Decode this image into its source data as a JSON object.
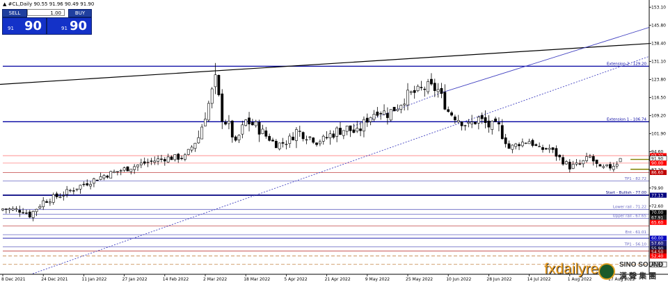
{
  "header": {
    "symbol_line": "#CL,Daily  90.55 91.96 90.49 91.90",
    "arrow_glyph": "▲"
  },
  "trade_panel": {
    "sell_label": "SELL",
    "buy_label": "BUY",
    "lot": "1.00",
    "sell_small": "91",
    "sell_big": "90",
    "buy_small": "91",
    "buy_big": "90"
  },
  "watermark": {
    "text": "fxdailyre",
    "brand": "SINO SOUND",
    "chinese": "漢 聲 集 團"
  },
  "colors": {
    "candle": "#000000",
    "level_line": "#0000a0",
    "channel_line": "#4040c0",
    "resistance_red": "#ff0000",
    "panel_blue": "#1432c8",
    "arrow_olive": "#808000"
  },
  "chart_data": {
    "type": "candlestick",
    "symbol": "#CL",
    "timeframe": "Daily",
    "ohlc_readout": [
      90.55,
      91.96,
      90.49,
      91.9
    ],
    "ylim": [
      45.0,
      156.0
    ],
    "y_ticks": [
      153.1,
      145.8,
      138.4,
      131.1,
      123.8,
      116.5,
      109.2,
      101.9,
      94.6,
      87.2,
      79.9,
      72.6
    ],
    "x_labels": [
      {
        "i": 0,
        "text": "8 Dec 2021"
      },
      {
        "i": 12,
        "text": "24 Dec 2021"
      },
      {
        "i": 24,
        "text": "11 Jan 2022"
      },
      {
        "i": 36,
        "text": "27 Jan 2022"
      },
      {
        "i": 48,
        "text": "14 Feb 2022"
      },
      {
        "i": 60,
        "text": "2 Mar 2022"
      },
      {
        "i": 72,
        "text": "18 Mar 2022"
      },
      {
        "i": 84,
        "text": "5 Apr 2022"
      },
      {
        "i": 96,
        "text": "21 Apr 2022"
      },
      {
        "i": 108,
        "text": "9 May 2022"
      },
      {
        "i": 120,
        "text": "25 May 2022"
      },
      {
        "i": 132,
        "text": "10 Jun 2022"
      },
      {
        "i": 144,
        "text": "28 Jun 2022"
      },
      {
        "i": 156,
        "text": "14 Jul 2022"
      },
      {
        "i": 168,
        "text": "1 Aug 2022"
      },
      {
        "i": 180,
        "text": "17 Aug 2022"
      }
    ],
    "anchors": [
      [
        0,
        71.5
      ],
      [
        6,
        70.8
      ],
      [
        8,
        69.0
      ],
      [
        12,
        74.5
      ],
      [
        18,
        77.5
      ],
      [
        24,
        81.5
      ],
      [
        30,
        85.0
      ],
      [
        36,
        87.5
      ],
      [
        42,
        90.0
      ],
      [
        48,
        92.0
      ],
      [
        54,
        92.5
      ],
      [
        58,
        100.5
      ],
      [
        61,
        114.0
      ],
      [
        63,
        124.0
      ],
      [
        65,
        108.5
      ],
      [
        67,
        105.0
      ],
      [
        69,
        98.0
      ],
      [
        72,
        107.0
      ],
      [
        75,
        105.0
      ],
      [
        78,
        101.0
      ],
      [
        81,
        97.5
      ],
      [
        84,
        98.5
      ],
      [
        87,
        103.0
      ],
      [
        90,
        101.5
      ],
      [
        93,
        98.5
      ],
      [
        96,
        100.5
      ],
      [
        99,
        103.0
      ],
      [
        102,
        104.0
      ],
      [
        105,
        102.0
      ],
      [
        108,
        108.0
      ],
      [
        111,
        111.5
      ],
      [
        114,
        110.0
      ],
      [
        117,
        113.0
      ],
      [
        120,
        117.5
      ],
      [
        123,
        119.0
      ],
      [
        126,
        121.0
      ],
      [
        129,
        119.5
      ],
      [
        132,
        111.0
      ],
      [
        135,
        108.0
      ],
      [
        138,
        105.0
      ],
      [
        141,
        108.0
      ],
      [
        144,
        105.0
      ],
      [
        147,
        104.5
      ],
      [
        150,
        96.0
      ],
      [
        153,
        98.0
      ],
      [
        156,
        99.0
      ],
      [
        159,
        95.5
      ],
      [
        162,
        96.0
      ],
      [
        165,
        92.0
      ],
      [
        168,
        88.5
      ],
      [
        171,
        89.5
      ],
      [
        174,
        92.5
      ],
      [
        177,
        87.5
      ],
      [
        180,
        88.5
      ],
      [
        183,
        91.0
      ]
    ],
    "last": {
      "open": 90.55,
      "high": 91.96,
      "low": 90.49,
      "close": 91.9
    },
    "trend_lines": [
      {
        "name": "long-trend",
        "points": [
          [
            -5,
            121.5
          ],
          [
            236,
            142.2
          ]
        ],
        "color": "#000000",
        "dash": false
      },
      {
        "name": "channel-support",
        "points": [
          [
            -2,
            40.0
          ],
          [
            240,
            156.5
          ]
        ],
        "color": "#4040c0",
        "dash": true
      },
      {
        "name": "channel-upper-dotted",
        "points": [
          [
            104,
            105.0
          ],
          [
            130,
            118.5
          ]
        ],
        "color": "#4040c0",
        "dash": true
      },
      {
        "name": "channel-upper",
        "points": [
          [
            130,
            118.5
          ],
          [
            236,
            164.0
          ]
        ],
        "color": "#4040c0",
        "dash": false
      }
    ],
    "levels": [
      {
        "name": "ext2",
        "value": 129.2,
        "color": "#0000a0",
        "width": 1.3,
        "start": 0,
        "label": "Extension 2 - 129.20"
      },
      {
        "name": "ext1",
        "value": 106.74,
        "color": "#0000a0",
        "width": 1.3,
        "start": 0,
        "label": "Extension 1 - 106.74"
      },
      {
        "name": "res-a",
        "value": 93.0,
        "color": "#ff8080",
        "width": 0.8,
        "start": 0,
        "label": ""
      },
      {
        "name": "res-b",
        "value": 90.0,
        "color": "#ff8080",
        "width": 0.8,
        "start": 0,
        "label": ""
      },
      {
        "name": "res-c",
        "value": 86.2,
        "color": "#c04040",
        "width": 0.8,
        "start": 0,
        "label": ""
      },
      {
        "name": "tp1-upper",
        "value": 82.72,
        "color": "#6060c0",
        "width": 0.8,
        "start": 0,
        "label": "TP1 - 82.72"
      },
      {
        "name": "start",
        "value": 77.0,
        "color": "#000080",
        "width": 1.8,
        "start": 0,
        "label": "Start - Bullish - 77.00"
      },
      {
        "name": "lower-rail",
        "value": 71.22,
        "color": "#6060c0",
        "width": 0.8,
        "start": 0,
        "label": "Lower rail - 71.22"
      },
      {
        "name": "ext-mid",
        "value": 69.3,
        "color": "#6060c0",
        "width": 0.8,
        "start": 0,
        "label": ""
      },
      {
        "name": "upper-rail",
        "value": 67.65,
        "color": "#6060c0",
        "width": 0.8,
        "start": 0,
        "label": "Upper rail - 67.65"
      },
      {
        "name": "mid-red",
        "value": 64.6,
        "color": "#c04040",
        "width": 0.8,
        "start": 0,
        "label": ""
      },
      {
        "name": "ent",
        "value": 61.01,
        "color": "#6060c0",
        "width": 0.8,
        "start": 0,
        "label": "Ent - 61.01"
      },
      {
        "name": "lvl-60",
        "value": 59.6,
        "color": "#0000a0",
        "width": 0.8,
        "start": 0,
        "label": ""
      },
      {
        "name": "tp1-lower",
        "value": 56.1,
        "color": "#6060c0",
        "width": 0.8,
        "start": 0,
        "label": "TP1 - 56.10"
      },
      {
        "name": "lvl-55",
        "value": 54.4,
        "color": "#c04040",
        "width": 0.8,
        "start": 0,
        "label": ""
      },
      {
        "name": "lvl-52",
        "value": 52.4,
        "color": "#c08040",
        "width": 0.8,
        "start": 0,
        "label": "",
        "dash": true
      },
      {
        "name": "lvl-49",
        "value": 49.0,
        "color": "#c08040",
        "width": 0.8,
        "start": 0,
        "label": "",
        "dash": true
      }
    ],
    "price_tags": [
      {
        "value": 93.0,
        "text": "93.22",
        "bg": "#ff0000",
        "fg": "#ffffff"
      },
      {
        "value": 91.9,
        "text": "91.90",
        "bg": "#ffffff",
        "fg": "#000000",
        "border": "#000000"
      },
      {
        "value": 90.0,
        "text": "90.00",
        "bg": "#ff0000",
        "fg": "#ffffff"
      },
      {
        "value": 86.2,
        "text": "86.60",
        "bg": "#c00000",
        "fg": "#ffffff"
      },
      {
        "value": 77.0,
        "text": "77.13",
        "bg": "#000080",
        "fg": "#ffffff"
      },
      {
        "value": 70.0,
        "text": "70.00",
        "bg": "#000000",
        "fg": "#ffffff"
      },
      {
        "value": 68.0,
        "text": "67.91",
        "bg": "#202020",
        "fg": "#ffffff"
      },
      {
        "value": 66.0,
        "text": "65.60",
        "bg": "#ff0000",
        "fg": "#ffffff"
      },
      {
        "value": 59.6,
        "text": "60.00",
        "bg": "#0000c0",
        "fg": "#ffffff"
      },
      {
        "value": 57.5,
        "text": "57.60",
        "bg": "#202080",
        "fg": "#ffffff"
      },
      {
        "value": 55.5,
        "text": "55.90",
        "bg": "#101040",
        "fg": "#ffffff"
      },
      {
        "value": 54.0,
        "text": "54.50",
        "bg": "#800000",
        "fg": "#ffffff"
      },
      {
        "value": 52.4,
        "text": "52.40",
        "bg": "#ff0000",
        "fg": "#ffffff"
      },
      {
        "value": 49.0,
        "text": "49.00",
        "bg": "#ffffff",
        "fg": "#000000",
        "border": "#000000"
      }
    ],
    "axis_only_labels": [
      {
        "value": 87.2,
        "text": "87.20"
      }
    ],
    "arrows": [
      {
        "from_i": 186,
        "to_i": 196,
        "value": 91.5,
        "color": "#808000"
      },
      {
        "from_i": 186,
        "to_i": 196,
        "value": 87.5,
        "color": "#808000"
      }
    ]
  }
}
